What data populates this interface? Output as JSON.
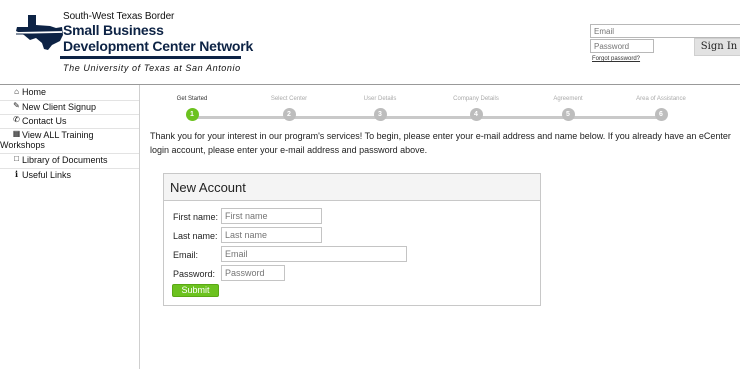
{
  "header": {
    "org_line1": "South-West Texas Border",
    "org_line2": "Small Business",
    "org_line3": "Development Center Network",
    "org_sub": "The University of Texas at San Antonio",
    "login": {
      "email_placeholder": "Email",
      "password_placeholder": "Password",
      "signin_label": "Sign In",
      "forgot_label": "Forgot password?"
    }
  },
  "sidebar": {
    "items": [
      {
        "label": "Home",
        "icon": "home-icon"
      },
      {
        "label": "New Client Signup",
        "icon": "pencil-icon"
      },
      {
        "label": "Contact Us",
        "icon": "phone-icon"
      },
      {
        "label_line1": "View ALL Training",
        "label_line2": "Workshops",
        "icon": "calendar-icon"
      },
      {
        "label": "Library of Documents",
        "icon": "document-icon"
      },
      {
        "label": "Useful Links",
        "icon": "info-icon"
      }
    ]
  },
  "wizard": {
    "steps": [
      {
        "label": "Get Started",
        "number": "1",
        "state": "active"
      },
      {
        "label": "Select Center",
        "number": "2",
        "state": "pending"
      },
      {
        "label": "User Details",
        "number": "3",
        "state": "pending"
      },
      {
        "label": "Company Details",
        "number": "4",
        "state": "pending"
      },
      {
        "label": "Agreement",
        "number": "5",
        "state": "pending"
      },
      {
        "label": "Area of Assistance",
        "number": "6",
        "state": "pending"
      }
    ]
  },
  "intro": {
    "text": "Thank you for your interest in our program's services! To begin, please enter your e-mail address and name below. If you already have an eCenter login account, please enter your e-mail address and password above."
  },
  "form": {
    "title": "New Account",
    "first_name_label": "First name:",
    "first_name_placeholder": "First name",
    "last_name_label": "Last name:",
    "last_name_placeholder": "Last name",
    "email_label": "Email:",
    "email_placeholder": "Email",
    "password_label": "Password:",
    "password_placeholder": "Password",
    "submit_label": "Submit"
  },
  "colors": {
    "brand_navy": "#0d2345",
    "accent_green": "#6cc21f",
    "step_inactive": "#bdbdbd"
  }
}
